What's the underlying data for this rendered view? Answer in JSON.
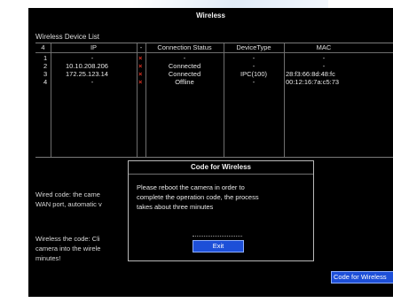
{
  "window": {
    "title": "Wireless"
  },
  "list": {
    "label": "Wireless Device List",
    "columns": [
      "4",
      "IP",
      "-",
      "Connection Status",
      "DeviceType",
      "MAC"
    ],
    "rows": [
      {
        "no": "1",
        "ip": "-",
        "status": "-",
        "type": "-",
        "mac": "-"
      },
      {
        "no": "2",
        "ip": "10.10.208.206",
        "status": "Connected",
        "type": "-",
        "mac": "-"
      },
      {
        "no": "3",
        "ip": "172.25.123.14",
        "status": "Connected",
        "type": "IPC(100)",
        "mac": "28:f3:66:8d:48:fc"
      },
      {
        "no": "4",
        "ip": "-",
        "status": "Offline",
        "type": "-",
        "mac": "00:12:16:7a:c5:73"
      }
    ],
    "x_mark": "×"
  },
  "info": {
    "wired_line1": "Wired code: the came",
    "wired_line2": "WAN port, automatic v",
    "wireless_line1": "Wireless the code: Cli",
    "wireless_line2": "camera into the wirele",
    "wireless_line3": "minutes!"
  },
  "dialog": {
    "title": "Code for Wireless",
    "message_line1": "Please reboot the camera in order to",
    "message_line2": "complete the operation code, the process",
    "message_line3": "takes about three minutes",
    "exit_label": "Exit"
  },
  "code_button": {
    "label": "Code for Wireless"
  }
}
